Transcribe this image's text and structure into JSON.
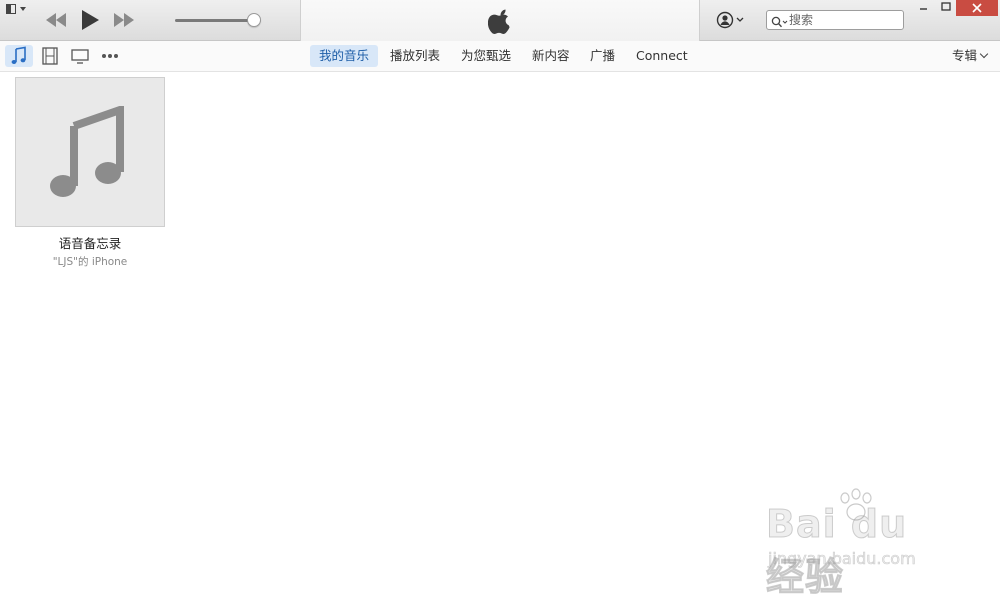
{
  "titlebar": {
    "search_placeholder": "搜索",
    "icons": {
      "sidebar": "sidebar-toggle-icon",
      "prev": "rewind-icon",
      "play": "play-icon",
      "next": "fast-forward-icon",
      "logo": "apple-logo-icon",
      "account": "account-icon",
      "search": "search-icon"
    },
    "volume_level": 0.92
  },
  "navbar": {
    "media_types": [
      {
        "name": "music-icon",
        "active": true
      },
      {
        "name": "movies-icon",
        "active": false
      },
      {
        "name": "tv-icon",
        "active": false
      },
      {
        "name": "more-icon",
        "active": false
      }
    ],
    "tabs": [
      {
        "label": "我的音乐",
        "active": true
      },
      {
        "label": "播放列表",
        "active": false
      },
      {
        "label": "为您甄选",
        "active": false
      },
      {
        "label": "新内容",
        "active": false
      },
      {
        "label": "广播",
        "active": false
      },
      {
        "label": "Connect",
        "active": false
      }
    ],
    "view_selector": "专辑"
  },
  "library": {
    "albums": [
      {
        "title": "语音备忘录",
        "artist": "\"LJS\"的 iPhone"
      }
    ]
  },
  "watermark": {
    "brand": "Bai du 经验",
    "url": "jingyan.baidu.com"
  },
  "colors": {
    "accent": "#1f5fa8",
    "tab_active_bg": "#d8e7f8",
    "close_button": "#c94c42"
  }
}
